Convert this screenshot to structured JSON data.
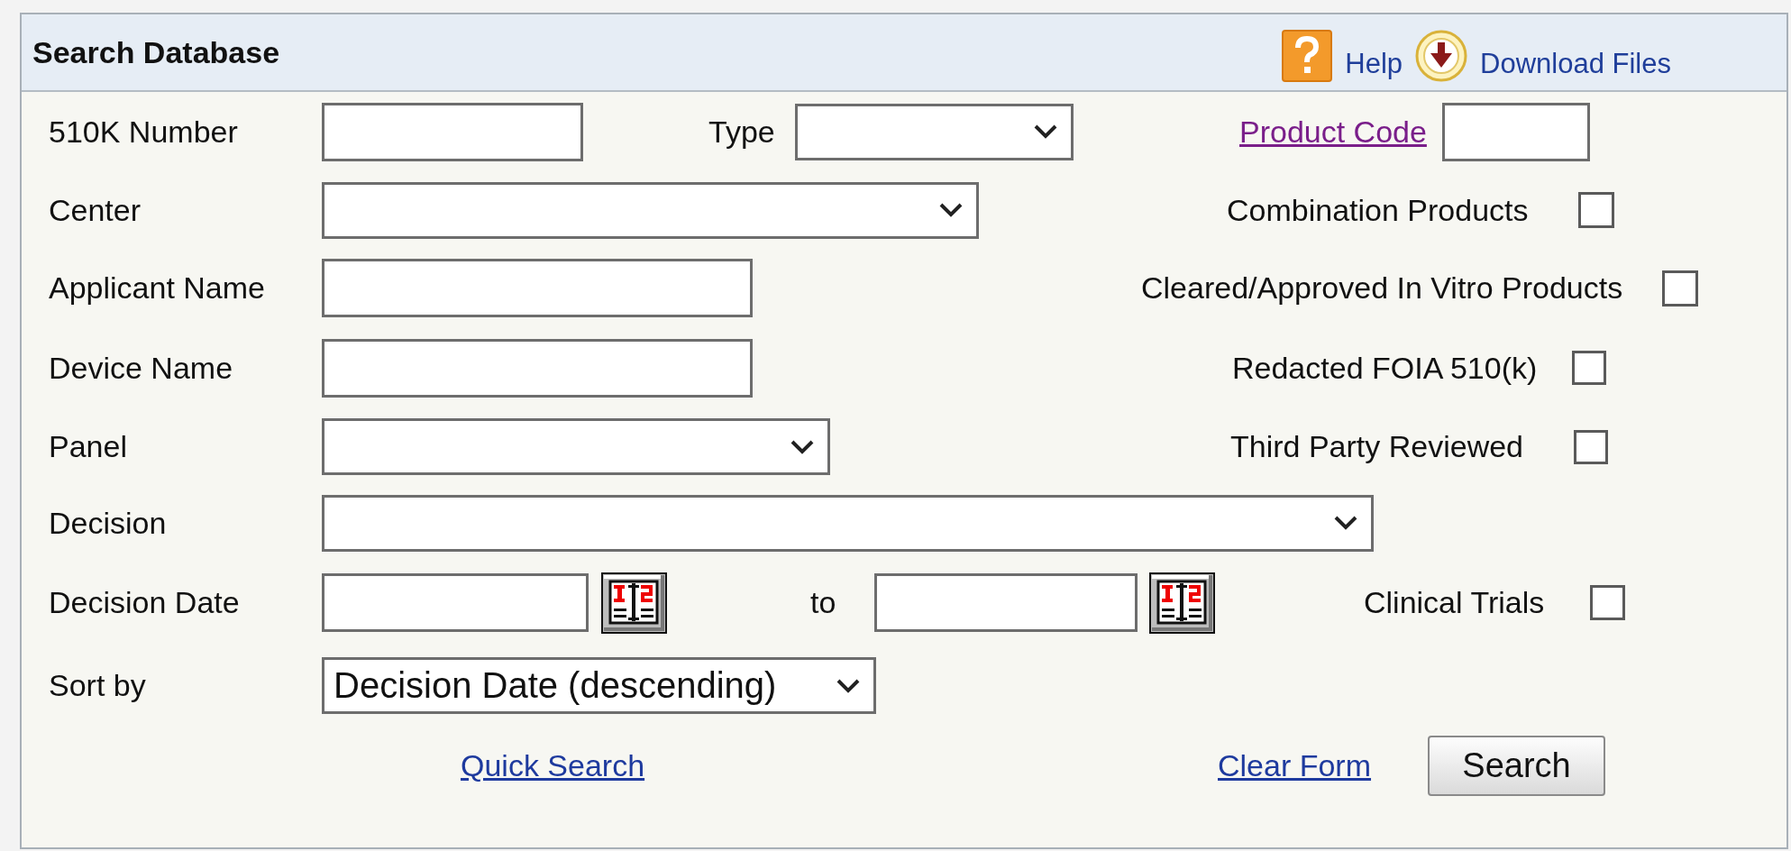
{
  "panel": {
    "title": "Search Database",
    "header_links": [
      {
        "kind": "help",
        "label": "Help"
      },
      {
        "kind": "download",
        "label": "Download Files"
      }
    ]
  },
  "form_rows": [
    [
      {
        "kind": "label",
        "text": "510K Number"
      },
      {
        "kind": "input"
      },
      {
        "kind": "label",
        "text": "Type"
      },
      {
        "kind": "select"
      },
      {
        "kind": "link",
        "text": "Product Code",
        "visited": true
      },
      {
        "kind": "input"
      }
    ],
    [
      {
        "kind": "label",
        "text": "Center"
      },
      {
        "kind": "select"
      },
      {
        "kind": "checkbox",
        "label": "Combination Products",
        "checked": false
      }
    ],
    [
      {
        "kind": "label",
        "text": "Applicant Name"
      },
      {
        "kind": "input"
      },
      {
        "kind": "checkbox",
        "label": "Cleared/Approved In Vitro Products",
        "checked": false
      }
    ],
    [
      {
        "kind": "label",
        "text": "Device Name"
      },
      {
        "kind": "input"
      },
      {
        "kind": "checkbox",
        "label": "Redacted FOIA 510(k)",
        "checked": false
      }
    ],
    [
      {
        "kind": "label",
        "text": "Panel"
      },
      {
        "kind": "select"
      },
      {
        "kind": "checkbox",
        "label": "Third Party Reviewed",
        "checked": false
      }
    ],
    [
      {
        "kind": "label",
        "text": "Decision"
      },
      {
        "kind": "select"
      }
    ],
    [
      {
        "kind": "label",
        "text": "Decision Date"
      },
      {
        "kind": "input"
      },
      {
        "kind": "calendar"
      },
      {
        "kind": "label",
        "text": "to"
      },
      {
        "kind": "input"
      },
      {
        "kind": "calendar"
      },
      {
        "kind": "checkbox",
        "label": "Clinical Trials",
        "checked": false
      }
    ],
    [
      {
        "kind": "label",
        "text": "Sort by"
      },
      {
        "kind": "select",
        "value": "Decision Date (descending)"
      }
    ],
    [
      {
        "kind": "link",
        "text": "Quick Search",
        "visited": false
      },
      {
        "kind": "link",
        "text": "Clear Form",
        "visited": false
      },
      {
        "kind": "button",
        "label": "Search"
      }
    ]
  ]
}
